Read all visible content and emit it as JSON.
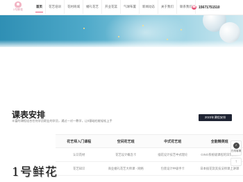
{
  "header": {
    "logo_text": "1号鲜花",
    "nav": [
      {
        "label": "首页",
        "active": true
      },
      {
        "label": "花艺培训"
      },
      {
        "label": "花材商城"
      },
      {
        "label": "婚礼花艺"
      },
      {
        "label": "开业花篮"
      },
      {
        "label": "气球布置"
      },
      {
        "label": "新闻动态"
      },
      {
        "label": "关于我们"
      },
      {
        "label": "联系我们"
      }
    ],
    "phone_icon": "phone-icon",
    "phone": "15671751510"
  },
  "banner": {
    "theme_colors": [
      "#2f8fb4",
      "#8fcde0",
      "#ffffff"
    ]
  },
  "section": {
    "title": "课表安排",
    "subtitle": "丰富的课程适合任何学员职业的学员，通过一对一教学，让0基础也能轻松上手",
    "badge": "2023年课程安排"
  },
  "table": {
    "headers": [
      "花艺师入门课程",
      "空间花艺班",
      "中式花艺班",
      "全能精英班"
    ],
    "rows": [
      [
        "认识花材",
        "花艺设计概念卡",
        "插花设计技艺中式理论",
        "GINO系统级课程的深刻赏析"
      ],
      [
        "花艺知识",
        "商业婚礼花艺大师课 - 网络",
        "包装设计中级手卡",
        "日本插花及其技法师课上讲课"
      ]
    ]
  },
  "watermark": "1号鲜花",
  "float": {
    "service_icon": "headset-icon",
    "service_label": "在线客服",
    "top_icon": "arrow-up-icon",
    "top_label": "↑"
  },
  "colors": {
    "accent": "#e75a7c",
    "badge_bg": "#1f2433"
  }
}
